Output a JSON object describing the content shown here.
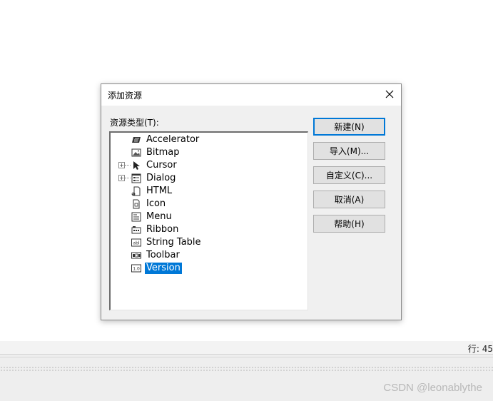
{
  "ide": {
    "status_line": "行: 45",
    "watermark": "CSDN @leonablythe"
  },
  "dialog": {
    "title": "添加资源",
    "type_label": "资源类型(T):",
    "items": [
      {
        "label": "Accelerator",
        "icon": "accelerator-icon",
        "expandable": false
      },
      {
        "label": "Bitmap",
        "icon": "bitmap-icon",
        "expandable": false
      },
      {
        "label": "Cursor",
        "icon": "cursor-icon",
        "expandable": true
      },
      {
        "label": "Dialog",
        "icon": "dialog-icon",
        "expandable": true
      },
      {
        "label": "HTML",
        "icon": "html-icon",
        "expandable": false
      },
      {
        "label": "Icon",
        "icon": "icon-resource-icon",
        "expandable": false
      },
      {
        "label": "Menu",
        "icon": "menu-icon",
        "expandable": false
      },
      {
        "label": "Ribbon",
        "icon": "ribbon-icon",
        "expandable": false
      },
      {
        "label": "String Table",
        "icon": "string-table-icon",
        "expandable": false
      },
      {
        "label": "Toolbar",
        "icon": "toolbar-icon",
        "expandable": false
      },
      {
        "label": "Version",
        "icon": "version-icon",
        "expandable": false,
        "selected": true
      }
    ],
    "buttons": {
      "new": "新建(N)",
      "import": "导入(M)...",
      "custom": "自定义(C)...",
      "cancel": "取消(A)",
      "help": "帮助(H)"
    },
    "colors": {
      "selection": "#0078d7",
      "default_button_border": "#0078d7"
    }
  }
}
